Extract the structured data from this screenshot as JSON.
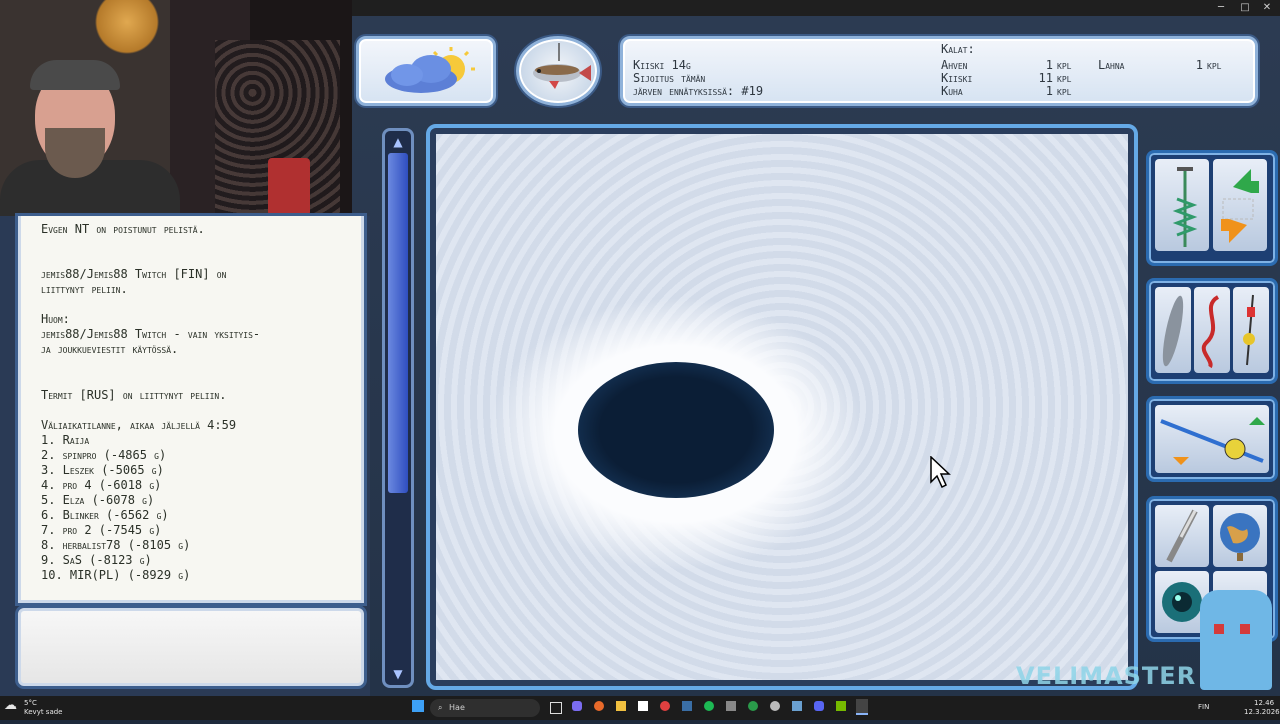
{
  "catch_panel": {
    "line1": "Kiiski 14g",
    "line2": "Sijoitus tämän",
    "line3": "järven ennätyksissä: #19",
    "fish_header": "Kalat:",
    "fish": [
      {
        "name": "Ahven",
        "count": "1",
        "unit": "kpl"
      },
      {
        "name": "Kiiski",
        "count": "11",
        "unit": "kpl"
      },
      {
        "name": "Kuha",
        "count": "1",
        "unit": "kpl"
      },
      {
        "name": "Lahna",
        "count": "1",
        "unit": "kpl"
      }
    ]
  },
  "chat": {
    "lines": [
      "Evgen NT on poistunut pelistä.",
      "",
      "",
      "jemis88/Jemis88 Twitch [FIN] on",
      "liittynyt peliin.",
      "",
      "Huom:",
      "jemis88/Jemis88 Twitch - vain yksityis-",
      "ja joukkueviestit käytössä.",
      "",
      "",
      "Termit [RUS] on liittynyt peliin.",
      "",
      "Väliaikatilanne, aikaa jäljellä 4:59",
      "1. Raija",
      "2. spinpro (-4865 g)",
      "3. Leszek (-5065 g)",
      "4. pro 4 (-6018 g)",
      "5. Elza (-6078 g)",
      "6. Blinker (-6562 g)",
      "7. pro 2 (-7545 g)",
      "8. herbalist78 (-8105 g)",
      "9. SaS (-8123 g)",
      "10. MIR(PL) (-8929 g)"
    ]
  },
  "watermark": "VELIMASTER",
  "taskbar": {
    "weather_temp": "5°C",
    "weather_desc": "Kevyt sade",
    "search_placeholder": "Hae",
    "lang": "FIN",
    "time": "12.46",
    "date": "12.3.2026"
  }
}
